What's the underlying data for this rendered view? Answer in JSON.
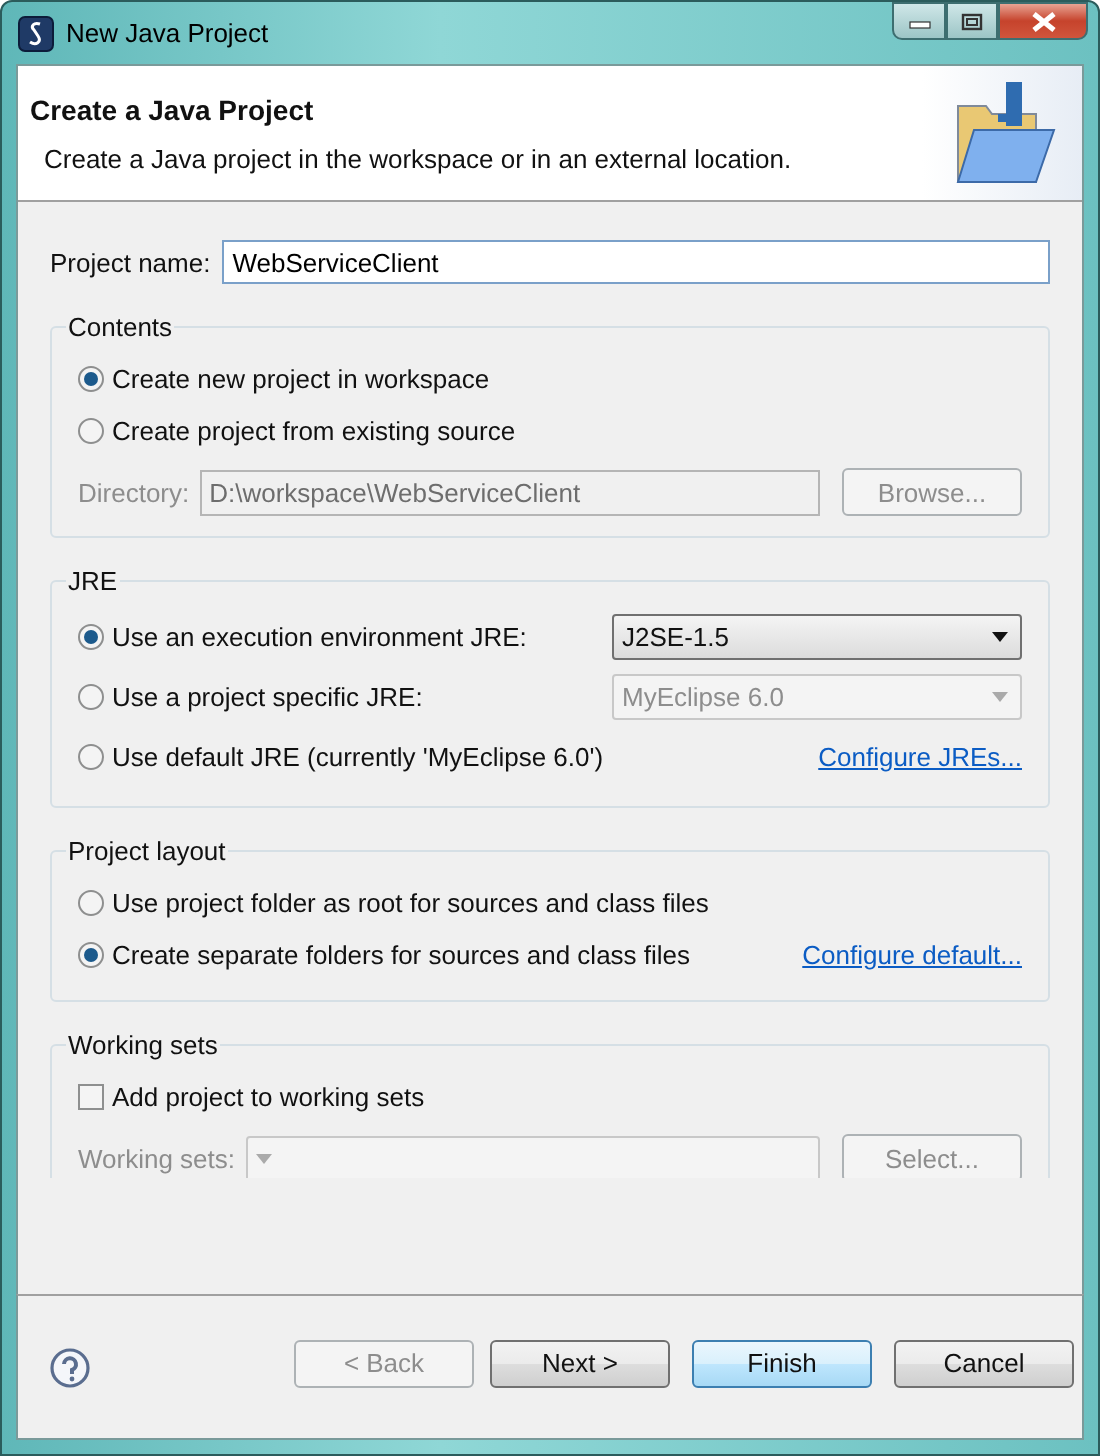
{
  "window": {
    "title": "New Java Project"
  },
  "header": {
    "title": "Create a Java Project",
    "description": "Create a Java project in the workspace or in an external location."
  },
  "project_name": {
    "label": "Project name:",
    "value": "WebServiceClient"
  },
  "contents": {
    "title": "Contents",
    "options": [
      {
        "label": "Create new project in workspace",
        "selected": true
      },
      {
        "label": "Create project from existing source",
        "selected": false
      }
    ],
    "directory": {
      "label": "Directory:",
      "value": "D:\\workspace\\WebServiceClient",
      "disabled": true
    },
    "browse": {
      "label": "Browse...",
      "disabled": true
    }
  },
  "jre": {
    "title": "JRE",
    "options": [
      {
        "label": "Use an execution environment JRE:",
        "selected": true,
        "trailing": {
          "kind": "combo",
          "value": "J2SE-1.5",
          "disabled": false
        }
      },
      {
        "label": "Use a project specific JRE:",
        "selected": false,
        "trailing": {
          "kind": "combo",
          "value": "MyEclipse 6.0",
          "disabled": true
        }
      },
      {
        "label": "Use default JRE (currently 'MyEclipse 6.0')",
        "selected": false,
        "trailing": {
          "kind": "link",
          "label": "Configure JREs..."
        }
      }
    ]
  },
  "project_layout": {
    "title": "Project layout",
    "options": [
      {
        "label": "Use project folder as root for sources and class files",
        "selected": false
      },
      {
        "label": "Create separate folders for sources and class files",
        "selected": true,
        "trailing": {
          "kind": "link",
          "label": "Configure default..."
        }
      }
    ]
  },
  "working_sets": {
    "title": "Working sets",
    "checkbox": {
      "label": "Add project to working sets",
      "checked": false
    },
    "field": {
      "label": "Working sets:",
      "disabled": true
    },
    "button": {
      "label": "Select...",
      "disabled": true
    }
  },
  "buttons": [
    {
      "label": "< Back",
      "disabled": true,
      "default": false
    },
    {
      "label": "Next >",
      "disabled": false,
      "default": false
    },
    {
      "label": "Finish",
      "disabled": false,
      "default": true
    },
    {
      "label": "Cancel",
      "disabled": false,
      "default": false
    }
  ]
}
